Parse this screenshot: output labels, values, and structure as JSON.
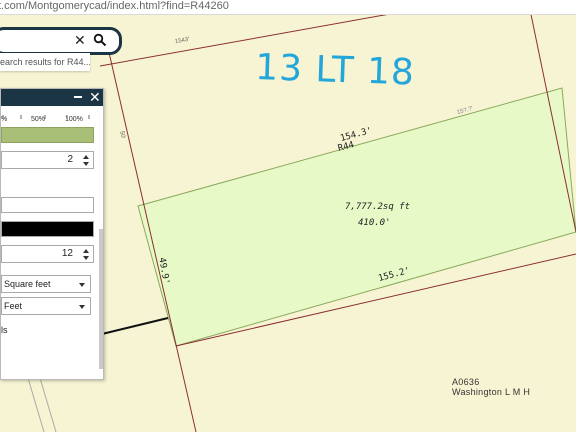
{
  "browser": {
    "url_fragment": "t.com/Montgomerycad/index.html?find=R44260"
  },
  "search": {
    "value": "",
    "results_hint": "earch results for R44..."
  },
  "map": {
    "subdivision_label": "13 LT 18",
    "dim_north": "154.3'",
    "dim_north_ref": "R44",
    "area": "7,777.2sq ft",
    "length": "410.0'",
    "dim_south": "155.2'",
    "dim_west": "49.9'",
    "small_label_1": "1543'",
    "small_label_2": "15?.?'",
    "small_label_3": "50'",
    "abstract_id": "A0636",
    "abstract_name": "Washington L M H",
    "colors": {
      "parcel_fill": "#e8f9c8",
      "parcel_line": "#8aa85c",
      "lot_line": "#8b2f2f",
      "label": "#23a6d9"
    }
  },
  "measure_panel": {
    "transparency_ticks": [
      "%",
      "50%",
      "100%"
    ],
    "spinner_1": "2",
    "spinner_2": "12",
    "area_unit": "Square feet",
    "length_unit": "Feet",
    "show_labels_text": "ls",
    "colors": {
      "fill": "#a9bf78",
      "line": "#000000"
    }
  }
}
